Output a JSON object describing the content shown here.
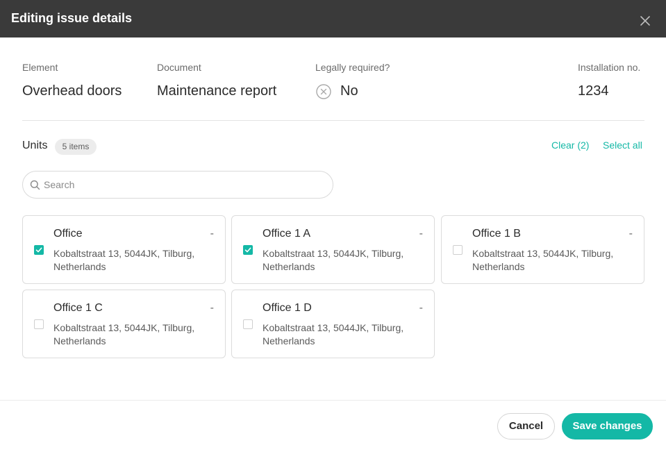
{
  "header": {
    "title": "Editing issue details"
  },
  "meta": {
    "element_label": "Element",
    "element_value": "Overhead doors",
    "document_label": "Document",
    "document_value": "Maintenance report",
    "legal_label": "Legally required?",
    "legal_value": "No",
    "installation_label": "Installation no.",
    "installation_value": "1234"
  },
  "units": {
    "label": "Units",
    "badge": "5 items",
    "clear_label": "Clear (2)",
    "select_all_label": "Select all"
  },
  "search": {
    "placeholder": "Search",
    "value": ""
  },
  "cards": [
    {
      "title": "Office",
      "dash": "-",
      "address": "Kobaltstraat 13, 5044JK, Tilburg, Netherlands",
      "checked": true
    },
    {
      "title": "Office 1 A",
      "dash": "-",
      "address": "Kobaltstraat 13, 5044JK, Tilburg, Netherlands",
      "checked": true
    },
    {
      "title": "Office 1 B",
      "dash": "-",
      "address": "Kobaltstraat 13, 5044JK, Tilburg, Netherlands",
      "checked": false
    },
    {
      "title": "Office 1 C",
      "dash": "-",
      "address": "Kobaltstraat 13, 5044JK, Tilburg, Netherlands",
      "checked": false
    },
    {
      "title": "Office 1 D",
      "dash": "-",
      "address": "Kobaltstraat 13, 5044JK, Tilburg, Netherlands",
      "checked": false
    }
  ],
  "footer": {
    "cancel_label": "Cancel",
    "save_label": "Save changes"
  },
  "colors": {
    "accent": "#14b8a6",
    "header_bg": "#3a3a3a"
  },
  "icons": {
    "close": "close-icon",
    "no": "circle-x-icon",
    "search": "search-icon",
    "check": "check-icon"
  }
}
